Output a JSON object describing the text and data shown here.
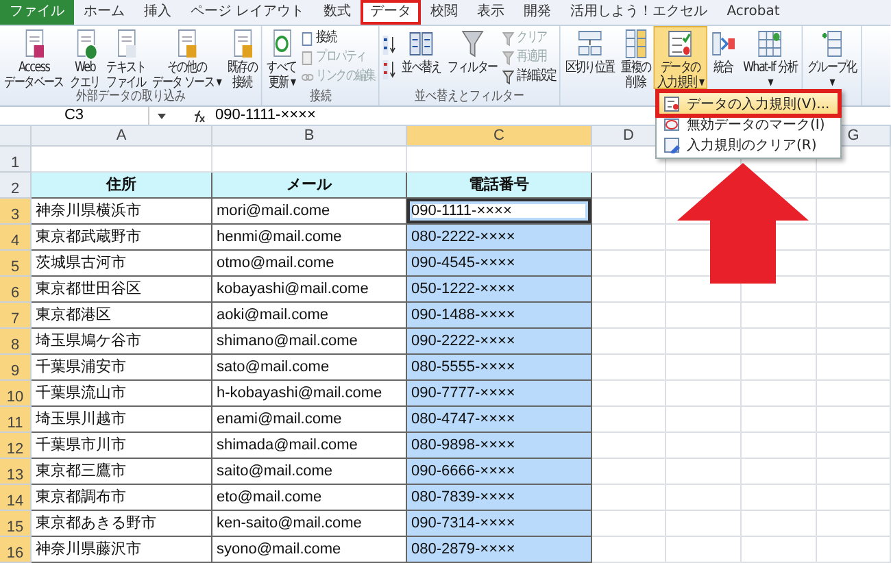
{
  "tabs": [
    {
      "label": "ファイル",
      "kind": "file",
      "selected": false,
      "annotated": false
    },
    {
      "label": "ホーム",
      "kind": "tab",
      "selected": false,
      "annotated": false
    },
    {
      "label": "挿入",
      "kind": "tab",
      "selected": false,
      "annotated": false
    },
    {
      "label": "ページ レイアウト",
      "kind": "tab",
      "selected": false,
      "annotated": false
    },
    {
      "label": "数式",
      "kind": "tab",
      "selected": false,
      "annotated": false
    },
    {
      "label": "データ",
      "kind": "tab",
      "selected": true,
      "annotated": true
    },
    {
      "label": "校閲",
      "kind": "tab",
      "selected": false,
      "annotated": false
    },
    {
      "label": "表示",
      "kind": "tab",
      "selected": false,
      "annotated": false
    },
    {
      "label": "開発",
      "kind": "tab",
      "selected": false,
      "annotated": false
    },
    {
      "label": "活用しよう！エクセル",
      "kind": "tab",
      "selected": false,
      "annotated": false
    },
    {
      "label": "Acrobat",
      "kind": "tab",
      "selected": false,
      "annotated": false
    }
  ],
  "ribbon": {
    "groups": [
      {
        "label": "外部データの取り込み",
        "columns": [
          {
            "kind": "large",
            "lines": [
              "Access",
              "データベース"
            ],
            "pressed": false
          },
          {
            "kind": "large",
            "lines": [
              "Web",
              "クエリ"
            ],
            "pressed": false
          },
          {
            "kind": "large",
            "lines": [
              "テキスト",
              "ファイル"
            ],
            "pressed": false
          },
          {
            "kind": "large",
            "lines": [
              "その他の",
              "データ ソース ▾"
            ],
            "pressed": false
          },
          {
            "kind": "large",
            "lines": [
              "既存の",
              "接続"
            ],
            "pressed": false
          }
        ]
      },
      {
        "label": "接続",
        "columns": [
          {
            "kind": "large",
            "lines": [
              "すべて",
              "更新 ▾"
            ],
            "pressed": false
          },
          {
            "kind": "stack",
            "items": [
              {
                "label": "接続",
                "disabled": false
              },
              {
                "label": "プロパティ",
                "disabled": true
              },
              {
                "label": "リンクの編集",
                "disabled": true
              }
            ]
          }
        ]
      },
      {
        "label": "並べ替えとフィルター",
        "columns": [
          {
            "kind": "sort"
          },
          {
            "kind": "large",
            "lines": [
              "並べ替え"
            ],
            "pressed": false
          },
          {
            "kind": "large",
            "lines": [
              "フィルター"
            ],
            "pressed": false
          },
          {
            "kind": "stack",
            "items": [
              {
                "label": "クリア",
                "disabled": true
              },
              {
                "label": "再適用",
                "disabled": true
              },
              {
                "label": "詳細設定",
                "disabled": false
              }
            ]
          }
        ]
      },
      {
        "columns": [
          {
            "kind": "large",
            "lines": [
              "区切り位置"
            ],
            "pressed": false
          },
          {
            "kind": "large",
            "lines": [
              "重複の",
              "削除"
            ],
            "pressed": false
          },
          {
            "kind": "large",
            "lines": [
              "データの",
              "入力規則 ▾"
            ],
            "pressed": true
          },
          {
            "kind": "large",
            "lines": [
              "統合"
            ],
            "pressed": false
          },
          {
            "kind": "large",
            "lines": [
              "What-If 分析",
              "▾"
            ],
            "pressed": false
          }
        ]
      },
      {
        "columns": [
          {
            "kind": "large",
            "lines": [
              "グループ化",
              "▾"
            ],
            "pressed": false
          }
        ]
      }
    ]
  },
  "menu": {
    "items": [
      {
        "label": "データの入力規則(V)...",
        "selected": true,
        "annotated": true
      },
      {
        "label": "無効データのマーク(I)",
        "selected": false,
        "annotated": false
      },
      {
        "label": "入力規則のクリア(R)",
        "selected": false,
        "annotated": false
      }
    ]
  },
  "formula_bar": {
    "name_box": "C3",
    "formula": "090-1111-××××"
  },
  "sheet": {
    "columns": [
      {
        "kind": "column",
        "label": "A",
        "selected": false
      },
      {
        "kind": "column",
        "label": "B",
        "selected": false
      },
      {
        "kind": "column",
        "label": "C",
        "selected": true
      },
      {
        "kind": "column",
        "label": "D",
        "selected": false
      },
      {
        "kind": "covered"
      },
      {
        "kind": "covered"
      },
      {
        "kind": "column",
        "label": "G",
        "selected": false
      }
    ],
    "rows": [
      {
        "number": "1",
        "selected": false,
        "cells": []
      },
      {
        "number": "2",
        "selected": false,
        "cells": [
          {
            "text": "住所",
            "kind": "header",
            "selected": false,
            "active": false
          },
          {
            "text": "メール",
            "kind": "header",
            "selected": false,
            "active": false
          },
          {
            "text": "電話番号",
            "kind": "header",
            "selected": false,
            "active": false
          }
        ]
      },
      {
        "number": "3",
        "selected": true,
        "cells": [
          {
            "text": "神奈川県横浜市",
            "kind": "data",
            "selected": false,
            "active": false
          },
          {
            "text": "mori@mail.come",
            "kind": "data",
            "selected": false,
            "active": false
          },
          {
            "text": "090-1111-××××",
            "kind": "data",
            "selected": true,
            "active": true
          }
        ]
      },
      {
        "number": "4",
        "selected": true,
        "cells": [
          {
            "text": "東京都武蔵野市",
            "kind": "data",
            "selected": false,
            "active": false
          },
          {
            "text": "henmi@mail.come",
            "kind": "data",
            "selected": false,
            "active": false
          },
          {
            "text": "080-2222-××××",
            "kind": "data",
            "selected": true,
            "active": false
          }
        ]
      },
      {
        "number": "5",
        "selected": true,
        "cells": [
          {
            "text": "茨城県古河市",
            "kind": "data",
            "selected": false,
            "active": false
          },
          {
            "text": "otmo@mail.come",
            "kind": "data",
            "selected": false,
            "active": false
          },
          {
            "text": "090-4545-××××",
            "kind": "data",
            "selected": true,
            "active": false
          }
        ]
      },
      {
        "number": "6",
        "selected": true,
        "cells": [
          {
            "text": "東京都世田谷区",
            "kind": "data",
            "selected": false,
            "active": false
          },
          {
            "text": "kobayashi@mail.come",
            "kind": "data",
            "selected": false,
            "active": false
          },
          {
            "text": "050-1222-××××",
            "kind": "data",
            "selected": true,
            "active": false
          }
        ]
      },
      {
        "number": "7",
        "selected": true,
        "cells": [
          {
            "text": "東京都港区",
            "kind": "data",
            "selected": false,
            "active": false
          },
          {
            "text": "aoki@mail.come",
            "kind": "data",
            "selected": false,
            "active": false
          },
          {
            "text": "090-1488-××××",
            "kind": "data",
            "selected": true,
            "active": false
          }
        ]
      },
      {
        "number": "8",
        "selected": true,
        "cells": [
          {
            "text": "埼玉県鳩ケ谷市",
            "kind": "data",
            "selected": false,
            "active": false
          },
          {
            "text": "shimano@mail.come",
            "kind": "data",
            "selected": false,
            "active": false
          },
          {
            "text": "090-2222-××××",
            "kind": "data",
            "selected": true,
            "active": false
          }
        ]
      },
      {
        "number": "9",
        "selected": true,
        "cells": [
          {
            "text": "千葉県浦安市",
            "kind": "data",
            "selected": false,
            "active": false
          },
          {
            "text": "sato@mail.come",
            "kind": "data",
            "selected": false,
            "active": false
          },
          {
            "text": "080-5555-××××",
            "kind": "data",
            "selected": true,
            "active": false
          }
        ]
      },
      {
        "number": "10",
        "selected": true,
        "cells": [
          {
            "text": "千葉県流山市",
            "kind": "data",
            "selected": false,
            "active": false
          },
          {
            "text": "h-kobayashi@mail.come",
            "kind": "data",
            "selected": false,
            "active": false
          },
          {
            "text": "090-7777-××××",
            "kind": "data",
            "selected": true,
            "active": false
          }
        ]
      },
      {
        "number": "11",
        "selected": true,
        "cells": [
          {
            "text": "埼玉県川越市",
            "kind": "data",
            "selected": false,
            "active": false
          },
          {
            "text": "enami@mail.come",
            "kind": "data",
            "selected": false,
            "active": false
          },
          {
            "text": "080-4747-××××",
            "kind": "data",
            "selected": true,
            "active": false
          }
        ]
      },
      {
        "number": "12",
        "selected": true,
        "cells": [
          {
            "text": "千葉県市川市",
            "kind": "data",
            "selected": false,
            "active": false
          },
          {
            "text": "shimada@mail.come",
            "kind": "data",
            "selected": false,
            "active": false
          },
          {
            "text": "080-9898-××××",
            "kind": "data",
            "selected": true,
            "active": false
          }
        ]
      },
      {
        "number": "13",
        "selected": true,
        "cells": [
          {
            "text": "東京都三鷹市",
            "kind": "data",
            "selected": false,
            "active": false
          },
          {
            "text": "saito@mail.come",
            "kind": "data",
            "selected": false,
            "active": false
          },
          {
            "text": "090-6666-××××",
            "kind": "data",
            "selected": true,
            "active": false
          }
        ]
      },
      {
        "number": "14",
        "selected": true,
        "cells": [
          {
            "text": "東京都調布市",
            "kind": "data",
            "selected": false,
            "active": false
          },
          {
            "text": "eto@mail.come",
            "kind": "data",
            "selected": false,
            "active": false
          },
          {
            "text": "080-7839-××××",
            "kind": "data",
            "selected": true,
            "active": false
          }
        ]
      },
      {
        "number": "15",
        "selected": true,
        "cells": [
          {
            "text": "東京都あきる野市",
            "kind": "data",
            "selected": false,
            "active": false
          },
          {
            "text": "ken-saito@mail.come",
            "kind": "data",
            "selected": false,
            "active": false
          },
          {
            "text": "090-7314-××××",
            "kind": "data",
            "selected": true,
            "active": false
          }
        ]
      },
      {
        "number": "16",
        "selected": true,
        "cells": [
          {
            "text": "神奈川県藤沢市",
            "kind": "data",
            "selected": false,
            "active": false
          },
          {
            "text": "syono@mail.come",
            "kind": "data",
            "selected": false,
            "active": false
          },
          {
            "text": "080-2879-××××",
            "kind": "data",
            "selected": true,
            "active": false
          }
        ]
      }
    ]
  },
  "annotations": [
    {
      "kind": "arrow"
    }
  ]
}
